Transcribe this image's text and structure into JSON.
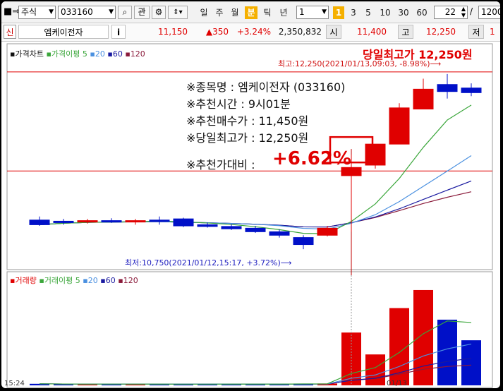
{
  "toolbar": {
    "market": "주식",
    "code": "033160",
    "watch_label": "관",
    "periods": [
      "일",
      "주",
      "월",
      "분",
      "틱",
      "년"
    ],
    "active_period": "분",
    "interval_value": "1",
    "intervals": [
      "1",
      "3",
      "5",
      "10",
      "30",
      "60"
    ],
    "active_interval": "1",
    "count_value": "22",
    "count_total": "1200"
  },
  "quote": {
    "badge": "신",
    "name": "엠케이전자",
    "info_label": "i",
    "price": "11,150",
    "change": "▲350",
    "change_pct": "+3.24%",
    "volume": "2,350,832",
    "open_label": "시",
    "open": "11,400",
    "high_label": "고",
    "high": "12,250",
    "low_label": "저",
    "low_partial": "1"
  },
  "price_panel": {
    "legend": {
      "price": "가격차트",
      "ma_label": "가격이평",
      "ma5": "5",
      "ma20": "20",
      "ma60": "60",
      "ma120": "120"
    },
    "day_high_title": "당일최고가 12,250원",
    "high_annotation": "최고:12,250(2021/01/13,09:03, -8.98%)⟶",
    "low_annotation": "최저:10,750(2021/01/12,15:17, +3.72%)⟶",
    "info_lines": [
      "※종목명 : 엠케이전자 (033160)",
      "※추천시간 : 9시01분",
      "※추천매수가 : 11,450원",
      "※당일최고가 : 12,250원"
    ],
    "ratio_label": "※추천가대비 :",
    "ratio_value": "+6.62%"
  },
  "volume_panel": {
    "legend": {
      "volume": "거래량",
      "ma_label": "거래이평",
      "ma5": "5",
      "ma20": "20",
      "ma60": "60",
      "ma120": "120"
    }
  },
  "colors": {
    "up": "#e00000",
    "down": "#0010c8",
    "ma5": "#3aa63a",
    "ma20": "#4a90e0",
    "ma60": "#1a1aa0",
    "ma120": "#8a1a3a",
    "accent": "#f5b000"
  },
  "chart_data": {
    "type": "candlestick",
    "date_start": "2021/01/12",
    "date_end": "2021/01/13",
    "ylim": [
      10600,
      12400
    ],
    "candles": [
      {
        "o": 11000,
        "h": 11030,
        "l": 10950,
        "c": 10960
      },
      {
        "o": 10990,
        "h": 11010,
        "l": 10960,
        "c": 10985
      },
      {
        "o": 10990,
        "h": 11010,
        "l": 10970,
        "c": 10995
      },
      {
        "o": 10995,
        "h": 11015,
        "l": 10975,
        "c": 10990
      },
      {
        "o": 10985,
        "h": 11010,
        "l": 10960,
        "c": 10995
      },
      {
        "o": 11000,
        "h": 11030,
        "l": 10960,
        "c": 10995
      },
      {
        "o": 11010,
        "h": 11020,
        "l": 10940,
        "c": 10950
      },
      {
        "o": 10960,
        "h": 10980,
        "l": 10935,
        "c": 10945
      },
      {
        "o": 10945,
        "h": 10965,
        "l": 10915,
        "c": 10925
      },
      {
        "o": 10930,
        "h": 10950,
        "l": 10890,
        "c": 10900
      },
      {
        "o": 10900,
        "h": 10920,
        "l": 10850,
        "c": 10870
      },
      {
        "o": 10850,
        "h": 10870,
        "l": 10750,
        "c": 10790
      },
      {
        "o": 10870,
        "h": 10950,
        "l": 10860,
        "c": 10930
      },
      {
        "o": 11380,
        "h": 11560,
        "l": 10900,
        "c": 11450
      },
      {
        "o": 11470,
        "h": 11650,
        "l": 11440,
        "c": 11650
      },
      {
        "o": 11650,
        "h": 12000,
        "l": 11650,
        "c": 11960
      },
      {
        "o": 11950,
        "h": 12210,
        "l": 11950,
        "c": 12120
      },
      {
        "o": 12160,
        "h": 12250,
        "l": 12040,
        "c": 12100
      },
      {
        "o": 12130,
        "h": 12170,
        "l": 12060,
        "c": 12090
      }
    ],
    "volume": [
      2400,
      1800,
      1700,
      2100,
      1900,
      2000,
      1600,
      1700,
      2300,
      1900,
      2200,
      2800,
      2900,
      82000,
      48000,
      120000,
      148000,
      102000,
      70000
    ],
    "volume_ylim": [
      0,
      160000
    ],
    "volume_x_labels": [
      "15:24",
      "01/13"
    ]
  }
}
